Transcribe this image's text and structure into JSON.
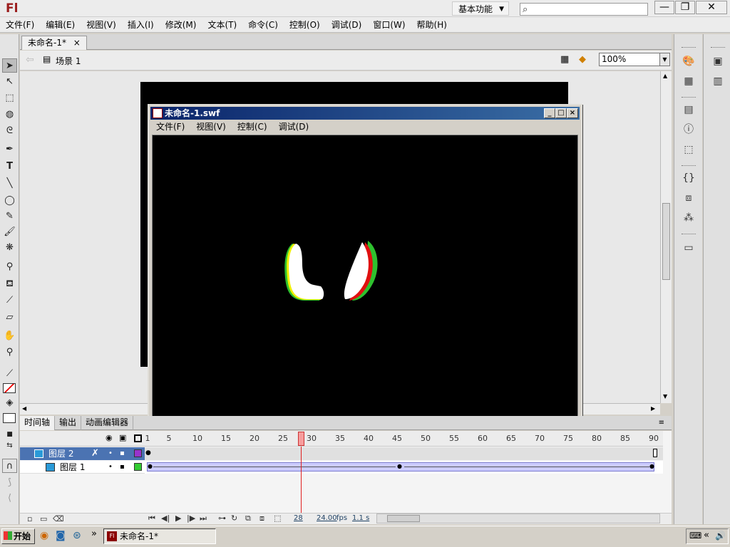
{
  "app": {
    "logo": "Fl",
    "workspace": "基本功能",
    "window_controls": [
      "—",
      "❐",
      "✕"
    ]
  },
  "menu": [
    "文件(F)",
    "编辑(E)",
    "视图(V)",
    "插入(I)",
    "修改(M)",
    "文本(T)",
    "命令(C)",
    "控制(O)",
    "调试(D)",
    "窗口(W)",
    "帮助(H)"
  ],
  "document": {
    "tab": "未命名-1*",
    "tab_close": "×",
    "scene": "场景 1",
    "zoom": "100%"
  },
  "swf_window": {
    "title": "未命名-1.swf",
    "menu": [
      "文件(F)",
      "视图(V)",
      "控制(C)",
      "调试(D)"
    ],
    "controls": [
      "_",
      "□",
      "×"
    ],
    "colors": {
      "green": "#2ec12e",
      "red": "#e01010",
      "yellow": "#f0f000",
      "white": "#ffffff"
    }
  },
  "timeline": {
    "tabs": [
      "时间轴",
      "输出",
      "动画编辑器"
    ],
    "ruler": [
      "1",
      "5",
      "10",
      "15",
      "20",
      "25",
      "30",
      "35",
      "40",
      "45",
      "50",
      "55",
      "60",
      "65",
      "70",
      "75",
      "80",
      "85",
      "90"
    ],
    "layers": [
      {
        "name": "图层 2",
        "selected": true,
        "color": "#9933cc"
      },
      {
        "name": "图层 1",
        "selected": false,
        "color": "#33cc33"
      }
    ],
    "current_frame": "28",
    "fps": "24.00",
    "fps_unit": "fps",
    "time": "1.1 s"
  },
  "taskbar": {
    "start": "开始",
    "tasks": [
      "未命名-1*"
    ],
    "more": "»",
    "tray_arrow": "«"
  },
  "icons": {
    "search": "⌕",
    "back": "⇦",
    "scene": "🎬",
    "fl_small": "Fl"
  }
}
